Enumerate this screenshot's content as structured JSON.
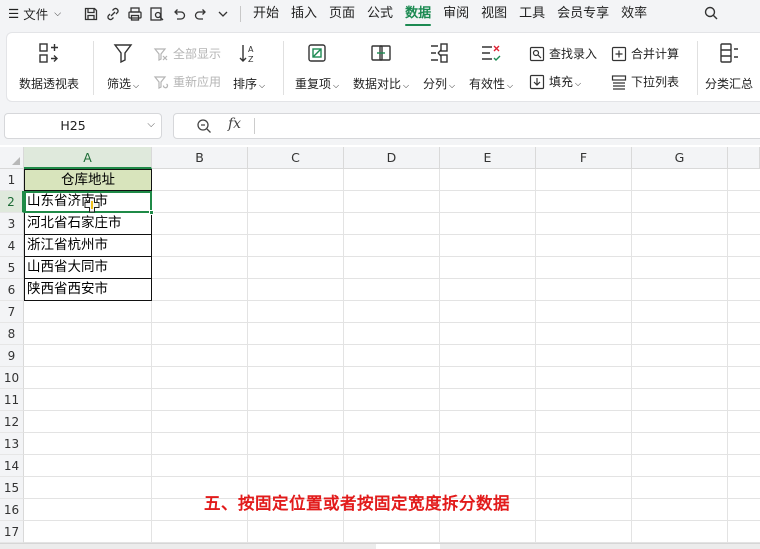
{
  "menubar": {
    "file_label": "文件",
    "tabs": [
      {
        "label": "开始",
        "active": false
      },
      {
        "label": "插入",
        "active": false
      },
      {
        "label": "页面",
        "active": false
      },
      {
        "label": "公式",
        "active": false
      },
      {
        "label": "数据",
        "active": true
      },
      {
        "label": "审阅",
        "active": false
      },
      {
        "label": "视图",
        "active": false
      },
      {
        "label": "工具",
        "active": false
      },
      {
        "label": "会员专享",
        "active": false
      },
      {
        "label": "效率",
        "active": false
      }
    ]
  },
  "ribbon": {
    "pivot": "数据透视表",
    "filter": "筛选",
    "show_all": "全部显示",
    "reapply": "重新应用",
    "sort": "排序",
    "duplicates": "重复项",
    "compare": "数据对比",
    "split": "分列",
    "validity": "有效性",
    "find_entry": "查找录入",
    "fill": "填充",
    "consolidate": "合并计算",
    "dropdown_list": "下拉列表",
    "subtotal": "分类汇总"
  },
  "formula_bar": {
    "name_box": "H25",
    "fx_label": "fx",
    "formula": ""
  },
  "sheet": {
    "columns": [
      "A",
      "B",
      "C",
      "D",
      "E",
      "F",
      "G"
    ],
    "selected_column": "A",
    "rows": [
      "1",
      "2",
      "3",
      "4",
      "5",
      "6",
      "7",
      "8",
      "9",
      "10",
      "11",
      "12",
      "13",
      "14",
      "15",
      "16",
      "17"
    ],
    "selected_row": "2",
    "cells": {
      "A1": "仓库地址",
      "A2": "山东省济南市",
      "A3": "河北省石家庄市",
      "A4": "浙江省杭州市",
      "A5": "山西省大同市",
      "A6": "陕西省西安市"
    },
    "header_fill": "#d8e4bc",
    "selection_color": "#1f8a47"
  },
  "caption": {
    "text": "五、按固定位置或者按固定宽度拆分数据",
    "color": "#e21b1b"
  }
}
